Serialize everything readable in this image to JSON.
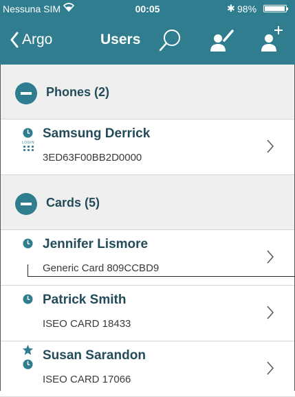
{
  "status_bar": {
    "carrier": "Nessuna SIM",
    "time": "00:05",
    "battery_text": "98%",
    "battery_level": 0.98
  },
  "nav": {
    "back_label": "Argo",
    "title": "Users"
  },
  "colors": {
    "accent": "#2f7d8f",
    "section_bg": "#efefef",
    "name_text": "#234b5a"
  },
  "icons": {
    "back": "chevron-left-icon",
    "search": "search-icon",
    "edit_user": "edit-user-icon",
    "add_user": "add-user-icon"
  },
  "sections": [
    {
      "label": "Phones (2)",
      "rows": [
        {
          "name": "Samsung Derrick",
          "sub": "3ED63F00BB2D0000",
          "icons": [
            "clock-icon",
            "login-icon"
          ],
          "login_text": "LOGIN"
        }
      ]
    },
    {
      "label": "Cards (5)",
      "rows": [
        {
          "name": "Jennifer Lismore",
          "sub": "Generic Card 809CCBD9",
          "icons": [
            "clock-icon"
          ]
        },
        {
          "name": "Patrick Smith",
          "sub": "ISEO CARD 18433",
          "icons": [
            "clock-icon"
          ]
        },
        {
          "name": "Susan Sarandon",
          "sub": "ISEO CARD 17066",
          "icons": [
            "star-icon",
            "clock-icon"
          ]
        }
      ]
    }
  ]
}
